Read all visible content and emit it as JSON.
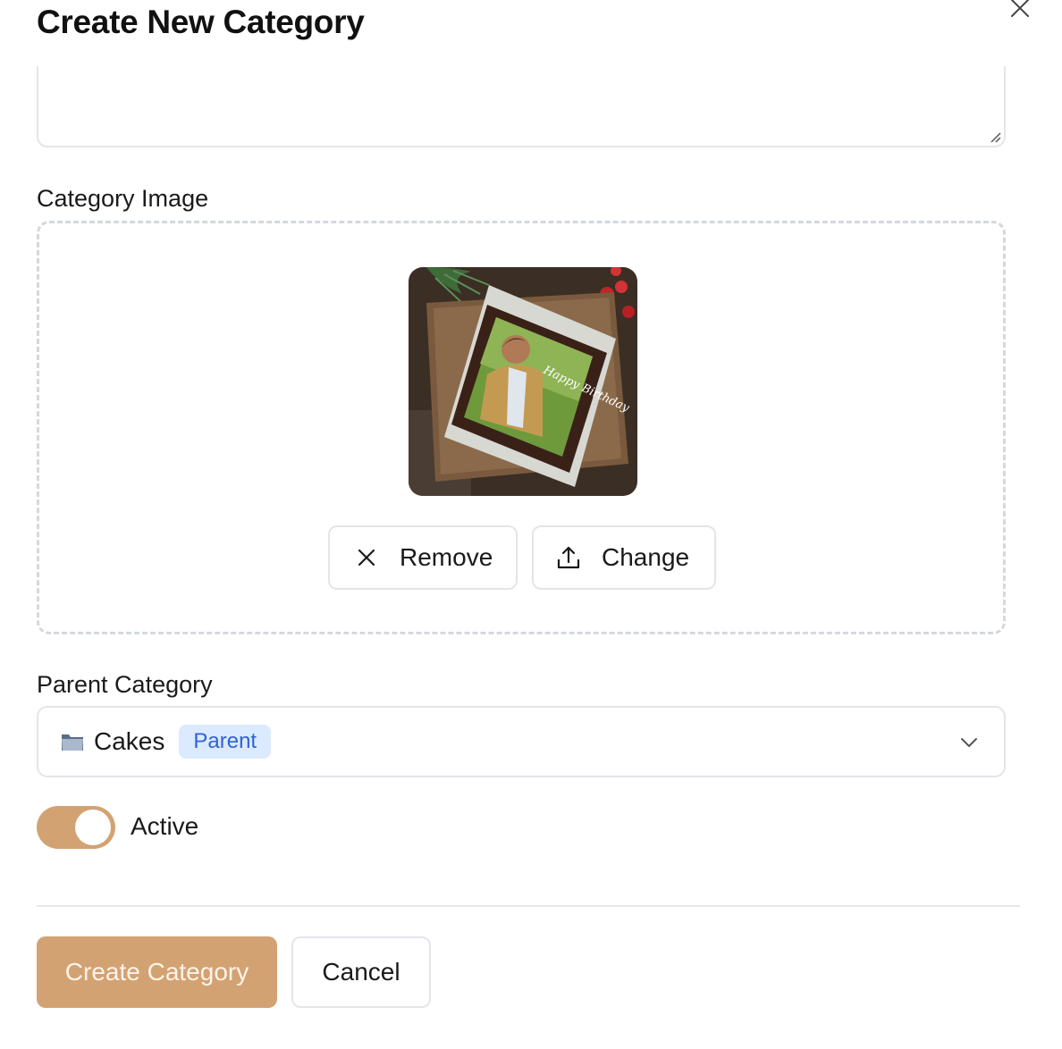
{
  "modal": {
    "title": "Create New Category",
    "close_icon": "close-icon"
  },
  "description": {
    "value": ""
  },
  "image_section": {
    "label": "Category Image",
    "preview_text": "Happy Birthday",
    "remove_label": "Remove",
    "remove_icon": "x-icon",
    "change_label": "Change",
    "change_icon": "upload-icon"
  },
  "parent_category": {
    "label": "Parent Category",
    "icon": "folder-icon",
    "selected": "Cakes",
    "badge": "Parent",
    "dropdown_icon": "chevron-down-icon"
  },
  "status": {
    "label": "Active",
    "enabled": true
  },
  "actions": {
    "submit_label": "Create Category",
    "cancel_label": "Cancel"
  },
  "colors": {
    "accent": "#d3a273",
    "badge_bg": "#dbeafe",
    "badge_text": "#2f63d6",
    "border": "#e3e5ea"
  }
}
